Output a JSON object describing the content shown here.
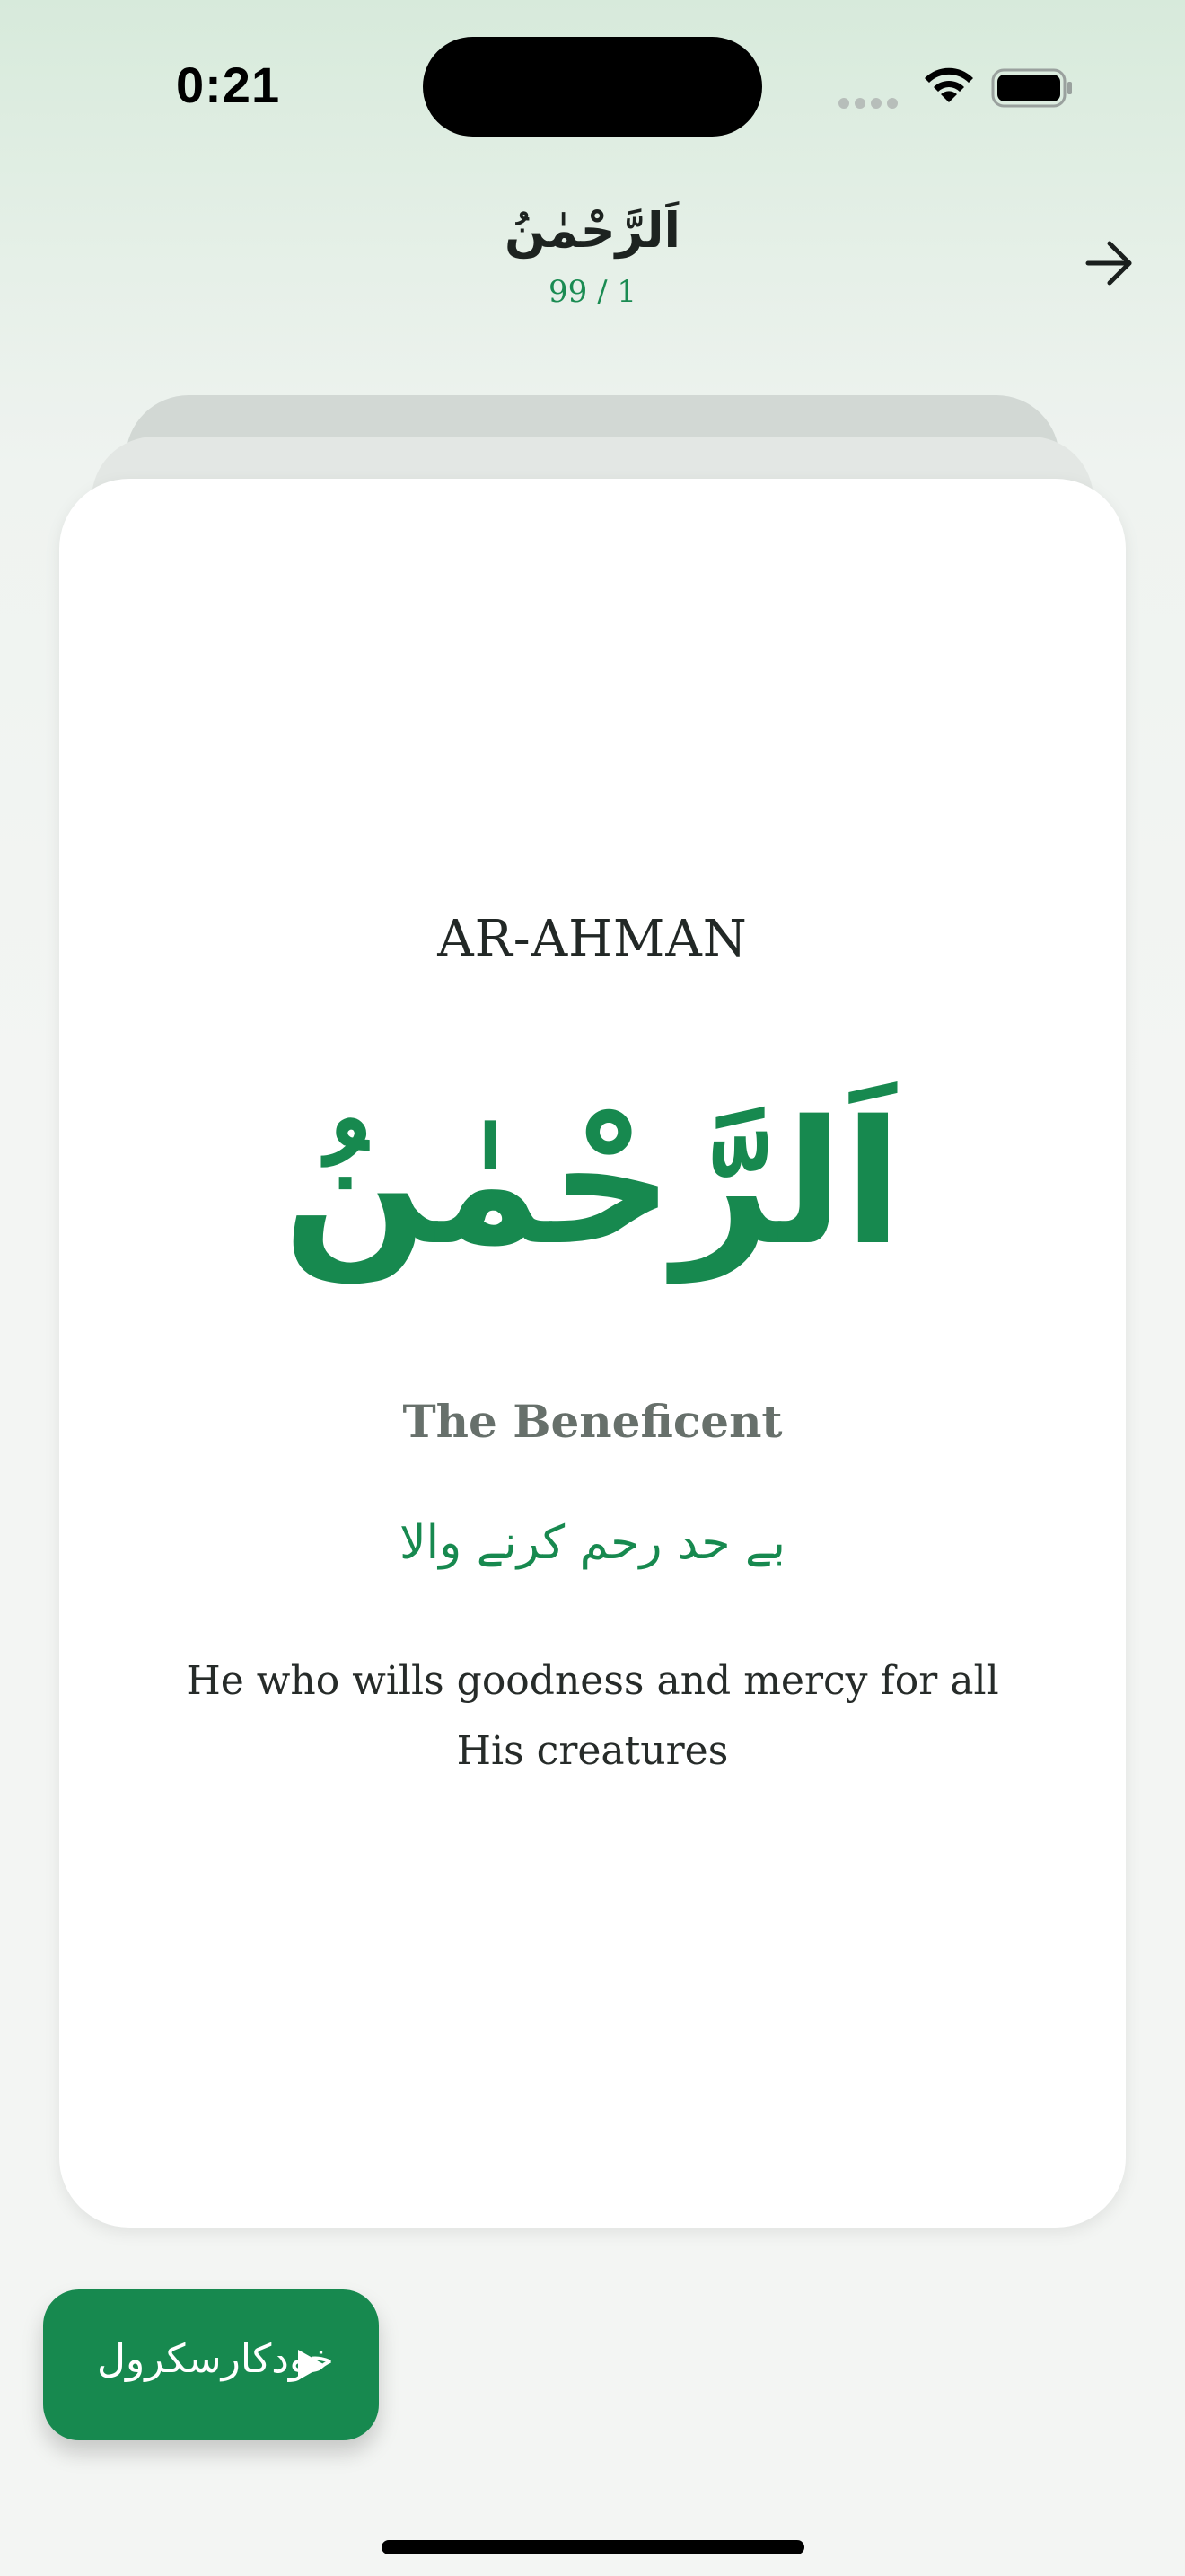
{
  "status_bar": {
    "time": "0:21",
    "icons": [
      "signal-dots-icon",
      "wifi-icon",
      "battery-icon"
    ]
  },
  "header": {
    "title": "اَلرَّحْمٰنُ",
    "counter": "99 / 1",
    "next_icon": "arrow-right-icon"
  },
  "card": {
    "transliteration": "AR-AHMAN",
    "arabic": "اَلرَّحْمٰنُ",
    "english": "The Beneficent",
    "urdu": "بے حد رحم کرنے والا",
    "meaning": "He who wills goodness and mercy for all His creatures"
  },
  "autoscroll": {
    "label": "خودکارسکرول",
    "icon": "play-icon"
  },
  "colors": {
    "accent": "#17894f",
    "muted_text": "#67706b"
  }
}
